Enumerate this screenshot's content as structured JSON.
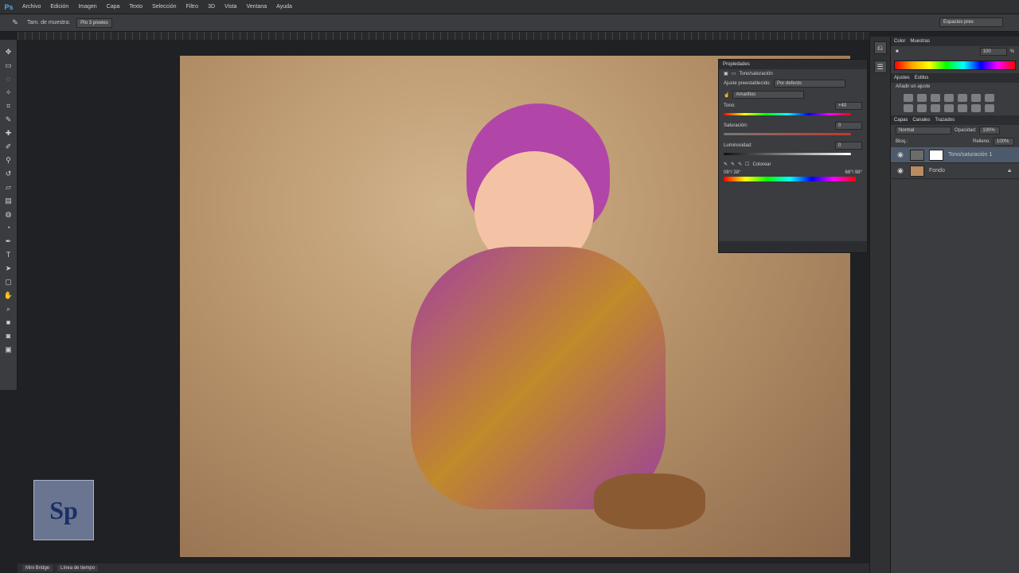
{
  "app": {
    "logo": "Ps"
  },
  "menu": [
    "Archivo",
    "Edición",
    "Imagen",
    "Capa",
    "Texto",
    "Selección",
    "Filtro",
    "3D",
    "Vista",
    "Ventana",
    "Ayuda"
  ],
  "options": {
    "sample_size_label": "Tam. de muestra:",
    "sample_size_value": "Pto 3 píxeles",
    "workspace": "Espacios prev."
  },
  "document_tabs": [
    "Mini Bridge",
    "Línea de tiempo"
  ],
  "watermark": {
    "text": "Sp"
  },
  "properties": {
    "title": "Propiedades",
    "panel_label": "Tono/saturación",
    "preset_label": "Ajuste preestablecido:",
    "preset_value": "Por defecto",
    "range_value": "Amarillos",
    "hue_label": "Tono:",
    "hue_value": "+40",
    "sat_label": "Saturación:",
    "sat_value": "0",
    "light_label": "Luminosidad:",
    "light_value": "0",
    "colorize_label": "Colorear",
    "range_text_left": "08°/ 38°",
    "range_text_right": "68°\\ 98°"
  },
  "right_panels": {
    "color_tabs": [
      "Color",
      "Muestras"
    ],
    "color_value": "100",
    "color_percent": "%",
    "adjust_tabs": [
      "Ajustes",
      "Estilos"
    ],
    "adjust_title": "Añadir un ajuste",
    "layers_tabs": [
      "Capas",
      "Canales",
      "Trazados"
    ],
    "blend_mode": "Normal",
    "opacity_label": "Opacidad:",
    "opacity_value": "100%",
    "fill_label": "Relleno:",
    "fill_value": "100%",
    "lock_label": "Bloq.:",
    "layers": [
      {
        "name": "Tono/saturación 1"
      },
      {
        "name": "Fondo"
      }
    ]
  }
}
